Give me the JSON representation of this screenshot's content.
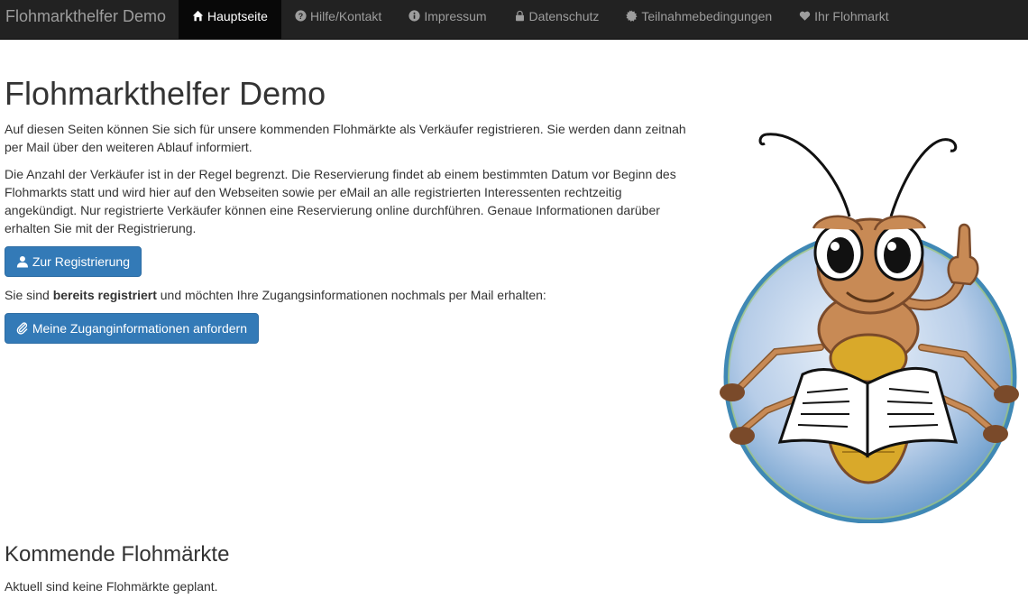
{
  "navbar": {
    "brand": "Flohmarkthelfer Demo",
    "items": [
      {
        "label": "Hauptseite",
        "icon": "home-icon",
        "active": true
      },
      {
        "label": "Hilfe/Kontakt",
        "icon": "question-circle-icon"
      },
      {
        "label": "Impressum",
        "icon": "info-circle-icon"
      },
      {
        "label": "Datenschutz",
        "icon": "lock-icon"
      },
      {
        "label": "Teilnahmebedingungen",
        "icon": "certificate-icon"
      },
      {
        "label": "Ihr Flohmarkt",
        "icon": "heart-icon"
      }
    ]
  },
  "main": {
    "title": "Flohmarkthelfer Demo",
    "intro1": "Auf diesen Seiten können Sie sich für unsere kommenden Flohmärkte als Verkäufer registrieren. Sie werden dann zeitnah per Mail über den weiteren Ablauf informiert.",
    "intro2": "Die Anzahl der Verkäufer ist in der Regel begrenzt. Die Reservierung findet ab einem bestimmten Datum vor Beginn des Flohmarkts statt und wird hier auf den Webseiten sowie per eMail an alle registrierten Interessenten rechtzeitig angekündigt. Nur registrierte Verkäufer können eine Reservierung online durchführen. Genaue Informationen darüber erhalten Sie mit der Registrierung.",
    "register_button": "Zur Registrierung",
    "already_prefix": "Sie sind ",
    "already_bold": "bereits registriert",
    "already_suffix": " und möchten Ihre Zugangsinformationen nochmals per Mail erhalten:",
    "info_button": "Meine Zuganginformationen anfordern",
    "upcoming_title": "Kommende Flohmärkte",
    "upcoming_text": "Aktuell sind keine Flohmärkte geplant."
  },
  "colors": {
    "navbar_bg": "#222222",
    "active_bg": "#080808",
    "button_primary": "#337ab7"
  }
}
